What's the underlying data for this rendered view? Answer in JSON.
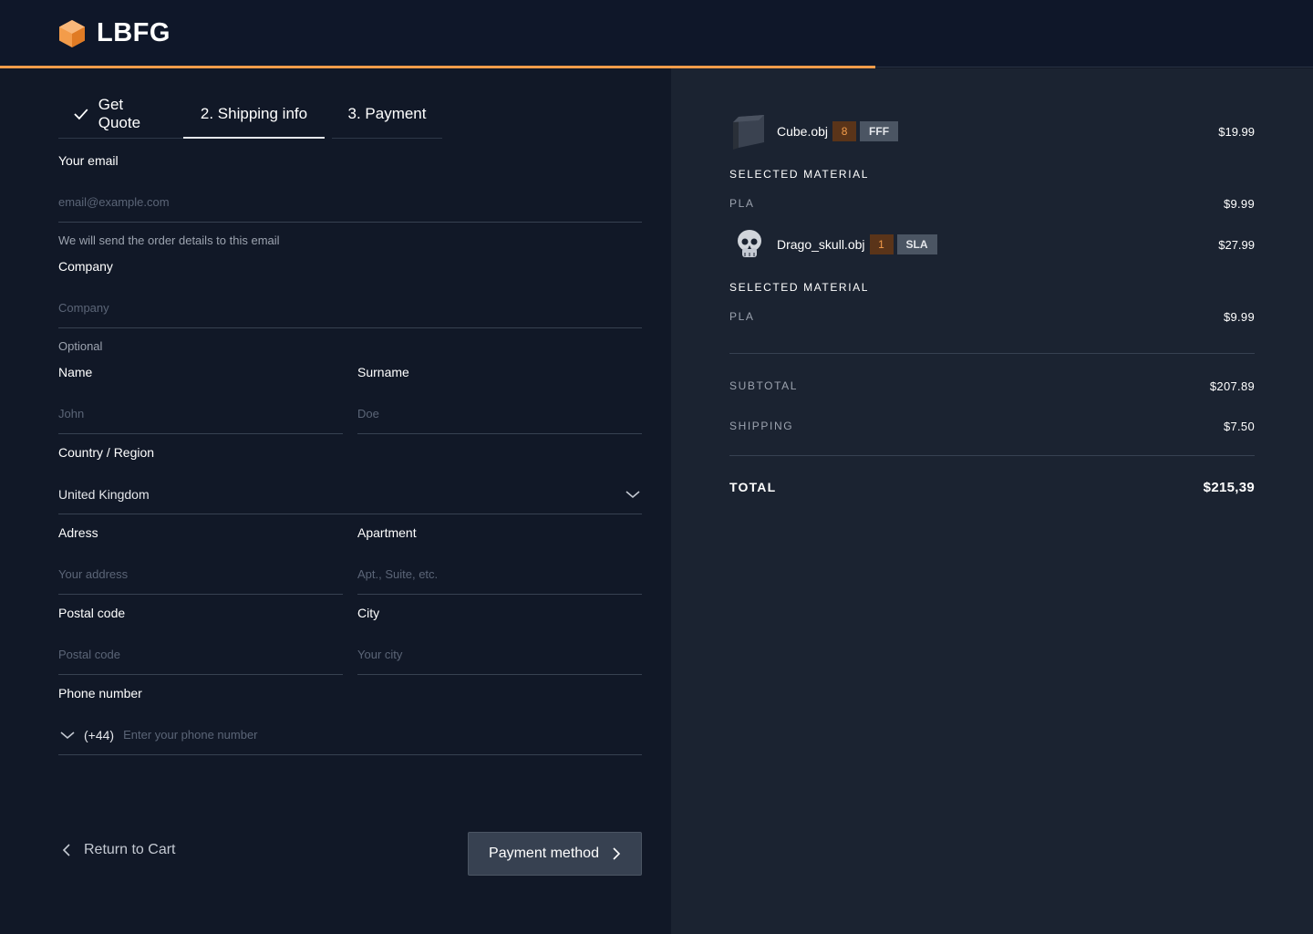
{
  "brand": {
    "name": "LBFG",
    "accent": "#f39c4a"
  },
  "checkout": {
    "progress_fraction": 0.667
  },
  "steps": [
    {
      "label": "Get Quote",
      "state": "done"
    },
    {
      "label": "2. Shipping info",
      "state": "active"
    },
    {
      "label": "3. Payment",
      "state": "upcoming"
    }
  ],
  "form": {
    "email": {
      "label": "Your email",
      "placeholder": "email@example.com",
      "help": "We will send the order details to this email"
    },
    "company": {
      "label": "Company",
      "placeholder": "Company",
      "help": "Optional"
    },
    "name": {
      "label": "Name",
      "placeholder": "John"
    },
    "surname": {
      "label": "Surname",
      "placeholder": "Doe"
    },
    "country": {
      "label": "Country / Region",
      "value": "United Kingdom"
    },
    "address": {
      "label": "Adress",
      "placeholder": "Your address"
    },
    "apartment": {
      "label": "Apartment",
      "placeholder": "Apt., Suite, etc."
    },
    "postal": {
      "label": "Postal code",
      "placeholder": "Postal code"
    },
    "city": {
      "label": "City",
      "placeholder": "Your city"
    },
    "phone": {
      "label": "Phone number",
      "code": "(+44)",
      "placeholder": "Enter your phone number"
    }
  },
  "actions": {
    "back": "Return to Cart",
    "next": "Payment method"
  },
  "summary": {
    "items": [
      {
        "name": "Cube.obj",
        "qty": "8",
        "tag": "FFF",
        "price": "$19.99",
        "material_heading": "SELECTED MATERIAL",
        "material": "PLA",
        "material_price": "$9.99",
        "icon": "cube-thumbnail"
      },
      {
        "name": "Drago_skull.obj",
        "qty": "1",
        "tag": "SLA",
        "price": "$27.99",
        "material_heading": "SELECTED MATERIAL",
        "material": "PLA",
        "material_price": "$9.99",
        "icon": "skull-thumbnail"
      }
    ],
    "subtotal_label": "SUBTOTAL",
    "subtotal": "$207.89",
    "shipping_label": "SHIPPING",
    "shipping": "$7.50",
    "total_label": "TOTAL",
    "total": "$215,39"
  }
}
